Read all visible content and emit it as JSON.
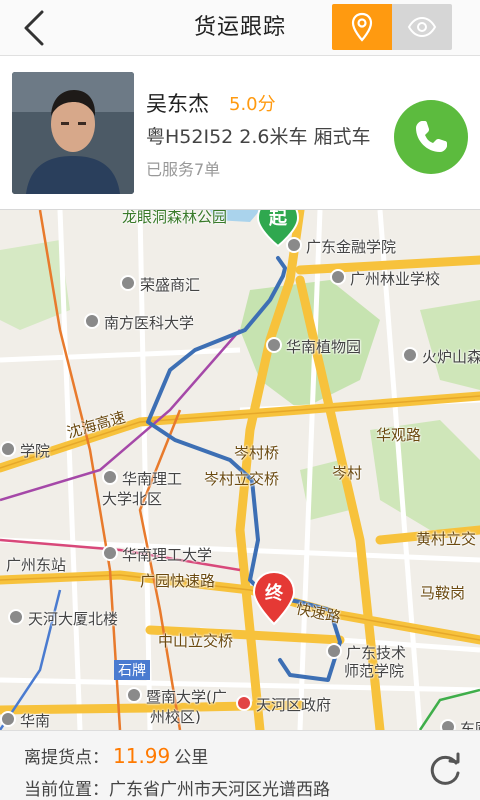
{
  "header": {
    "title": "货运跟踪",
    "back_icon": "chevron-left-icon",
    "tabs": [
      {
        "icon": "location-pin-icon",
        "active": true
      },
      {
        "icon": "eye-icon",
        "active": false
      }
    ]
  },
  "driver": {
    "name": "吴东杰",
    "rating": "5.0分",
    "vehicle": "粤H52I52 2.6米车 厢式车",
    "served": "已服务7单",
    "call_icon": "phone-icon"
  },
  "map": {
    "start_label": "起",
    "end_label": "终",
    "labels": {
      "l1": "龙眼洞森林公园",
      "l2": "广东金融学院",
      "l3": "广州林业学校",
      "l4": "荣盛商汇",
      "l5": "南方医科大学",
      "l6": "华南植物园",
      "l7": "火炉山森",
      "l8": "沈海高速",
      "l9": "学院",
      "l10": "岑村桥",
      "l11": "华观路",
      "l12": "岑村立交桥",
      "l13": "岑村",
      "l14": "华南理工",
      "l15": "大学北区",
      "l16": "黄村立交",
      "l17": "广州东站",
      "l18": "华南理工大学",
      "l19": "广园快速路",
      "l20": "马鞍岗",
      "l21": "天河大厦北楼",
      "l22": "快速路",
      "l23": "中山立交桥",
      "l24": "石牌",
      "l25": "广东技术",
      "l26": "师范学院",
      "l27": "暨南大学(广",
      "l28": "州校区)",
      "l29": "天河区政府",
      "l30": "华南",
      "l31": "东圃"
    },
    "colors": {
      "route": "#3d6fb4",
      "highway": "#f7c23c",
      "green": "#c6e3b0",
      "start_pin": "#2fa84f",
      "end_pin": "#e53935"
    }
  },
  "bottom": {
    "distance_label": "离提货点：",
    "distance_value": "11.99",
    "distance_unit": "公里",
    "location_label": "当前位置：",
    "location_value": "广东省广州市天河区光谱西路",
    "refresh_icon": "refresh-icon"
  }
}
